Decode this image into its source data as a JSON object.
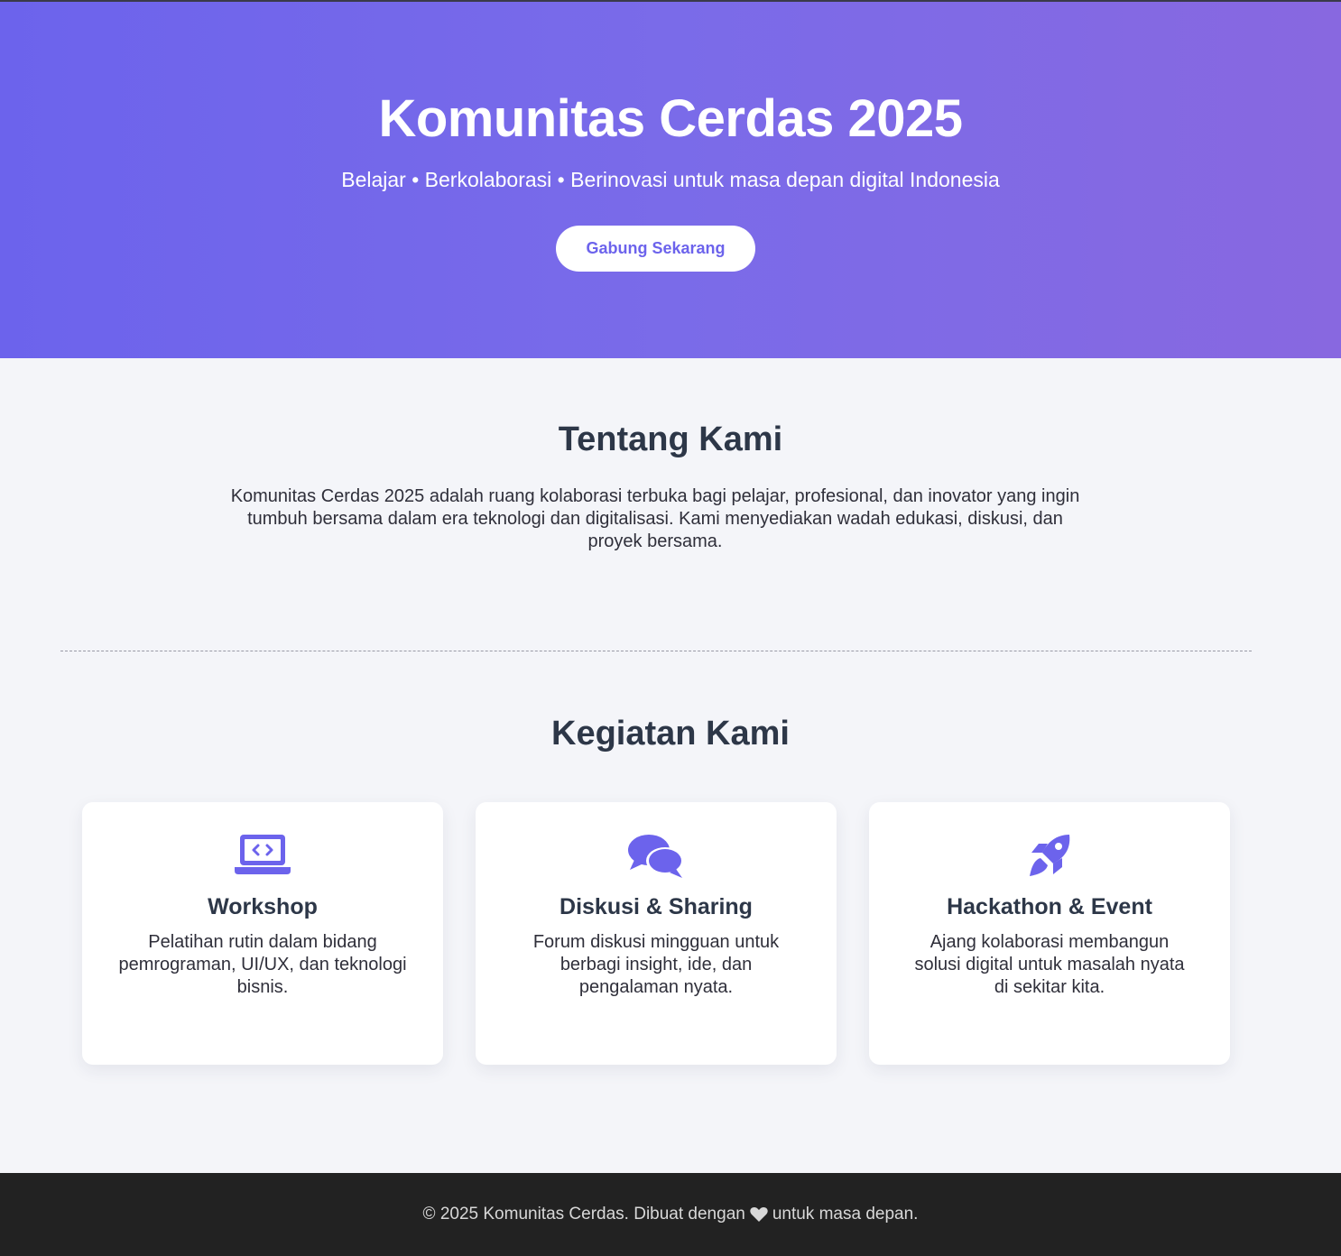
{
  "hero": {
    "title": "Komunitas Cerdas 2025",
    "tagline": "Belajar • Berkolaborasi • Berinovasi untuk masa depan digital Indonesia",
    "cta_label": "Gabung Sekarang"
  },
  "about": {
    "title": "Tentang Kami",
    "text": "Komunitas Cerdas 2025 adalah ruang kolaborasi terbuka bagi pelajar, profesional, dan inovator yang ingin tumbuh bersama dalam era teknologi dan digitalisasi. Kami menyediakan wadah edukasi, diskusi, dan proyek bersama."
  },
  "activities": {
    "title": "Kegiatan Kami",
    "cards": [
      {
        "icon": "laptop-code-icon",
        "title": "Workshop",
        "text": "Pelatihan rutin dalam bidang pemrograman, UI/UX, dan teknologi bisnis."
      },
      {
        "icon": "comments-icon",
        "title": "Diskusi & Sharing",
        "text": "Forum diskusi mingguan untuk berbagi insight, ide, dan pengalaman nyata."
      },
      {
        "icon": "rocket-icon",
        "title": "Hackathon & Event",
        "text": "Ajang kolaborasi membangun solusi digital untuk masalah nyata di sekitar kita."
      }
    ]
  },
  "footer": {
    "text_before": "© 2025 Komunitas Cerdas. Dibuat dengan",
    "icon": "heart-icon",
    "text_after": "untuk masa depan."
  },
  "colors": {
    "accent": "#6c63ec",
    "heading": "#2d3748",
    "footer_bg": "#222222",
    "page_bg": "#f4f5f9"
  }
}
